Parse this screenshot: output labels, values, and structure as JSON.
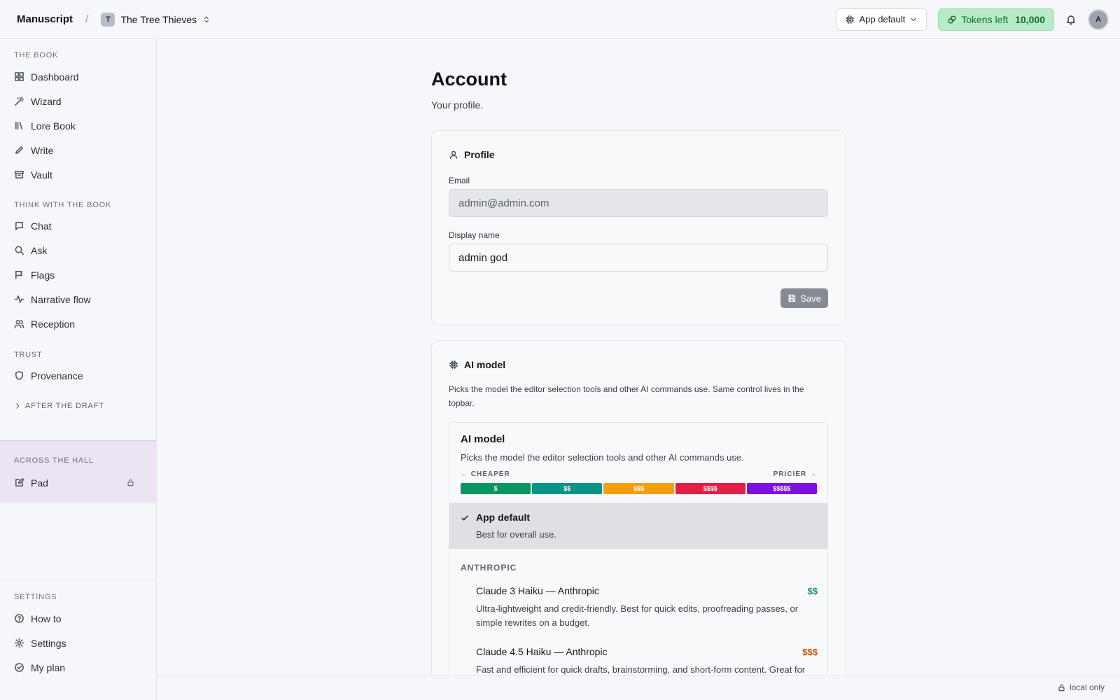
{
  "topbar": {
    "brand": "Manuscript",
    "separator": "/",
    "project_initial": "T",
    "project_name": "The Tree Thieves",
    "model_selector": "App default",
    "tokens_label": "Tokens left",
    "tokens_count": "10,000",
    "user_initial": "A"
  },
  "sidebar": {
    "the_book": {
      "title": "THE BOOK",
      "items": [
        {
          "label": "Dashboard",
          "icon": "grid-icon"
        },
        {
          "label": "Wizard",
          "icon": "wand-icon"
        },
        {
          "label": "Lore Book",
          "icon": "library-icon"
        },
        {
          "label": "Write",
          "icon": "pencil-icon"
        },
        {
          "label": "Vault",
          "icon": "archive-icon"
        }
      ]
    },
    "think": {
      "title": "THINK WITH THE BOOK",
      "items": [
        {
          "label": "Chat",
          "icon": "chat-icon"
        },
        {
          "label": "Ask",
          "icon": "search-icon"
        },
        {
          "label": "Flags",
          "icon": "flag-icon"
        },
        {
          "label": "Narrative flow",
          "icon": "activity-icon"
        },
        {
          "label": "Reception",
          "icon": "users-icon"
        }
      ]
    },
    "trust": {
      "title": "TRUST",
      "items": [
        {
          "label": "Provenance",
          "icon": "shield-icon"
        }
      ]
    },
    "after_draft": "AFTER THE DRAFT",
    "across_hall": {
      "title": "ACROSS THE HALL",
      "item": "Pad"
    },
    "settings": {
      "title": "SETTINGS",
      "items": [
        {
          "label": "How to",
          "icon": "help-icon"
        },
        {
          "label": "Settings",
          "icon": "gear-icon"
        },
        {
          "label": "My plan",
          "icon": "check-circle-icon"
        }
      ]
    }
  },
  "main": {
    "title": "Account",
    "subtitle": "Your profile.",
    "profile": {
      "heading": "Profile",
      "email_label": "Email",
      "email_value": "admin@admin.com",
      "display_name_label": "Display name",
      "display_name_value": "admin god",
      "save_label": "Save"
    },
    "ai_model": {
      "heading": "AI model",
      "description": "Picks the model the editor selection tools and other AI commands use. Same control lives in the topbar.",
      "panel_title": "AI model",
      "panel_desc": "Picks the model the editor selection tools and other AI commands use.",
      "cheaper": "← CHEAPER",
      "pricier": "PRICIER →",
      "tiers": [
        {
          "label": "$",
          "color": "#0a9660"
        },
        {
          "label": "$$",
          "color": "#0a9488"
        },
        {
          "label": "$$$",
          "color": "#f59e0b"
        },
        {
          "label": "$$$$",
          "color": "#e11d48"
        },
        {
          "label": "$$$$$",
          "color": "#7c10e0"
        }
      ],
      "selected": {
        "name": "App default",
        "desc": "Best for overall use."
      },
      "provider": "ANTHROPIC",
      "models": [
        {
          "name": "Claude 3 Haiku — Anthropic",
          "price": "$$",
          "price_color": "#0d8a7a",
          "desc": "Ultra-lightweight and credit-friendly. Best for quick edits, proofreading passes, or simple rewrites on a budget."
        },
        {
          "name": "Claude 4.5 Haiku — Anthropic",
          "price": "$$$",
          "price_color": "#c2530a",
          "desc": "Fast and efficient for quick drafts, brainstorming, and short-form content. Great for"
        }
      ]
    }
  },
  "footer": {
    "status": "local only"
  }
}
